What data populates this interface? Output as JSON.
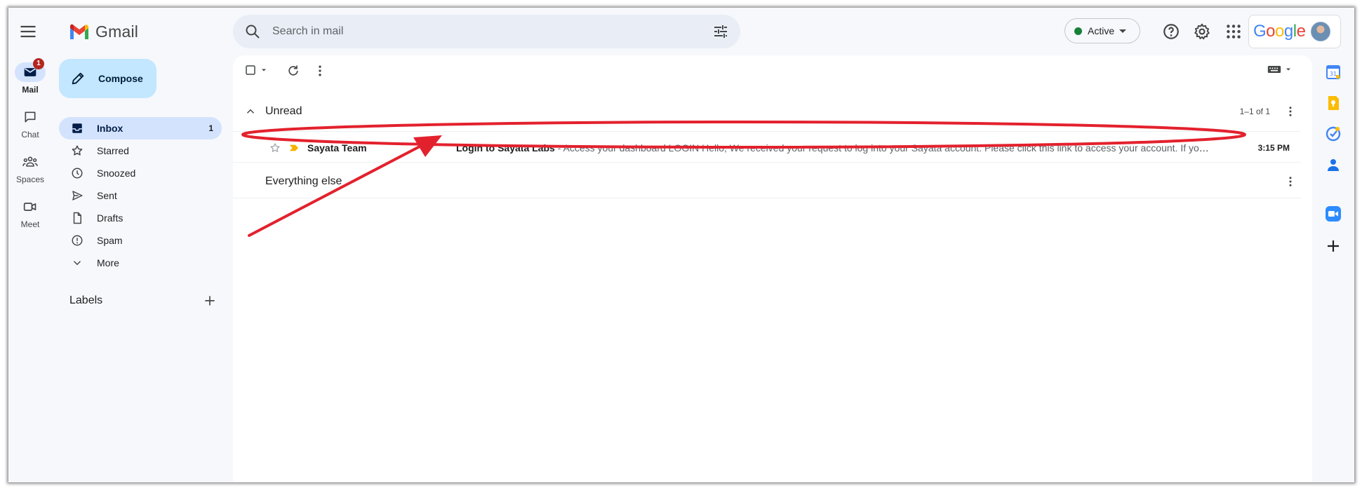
{
  "app": {
    "name": "Gmail"
  },
  "search": {
    "placeholder": "Search in mail"
  },
  "status": {
    "label": "Active",
    "color": "#188038"
  },
  "account": {
    "brand": "Google",
    "brand_colors": [
      "#4285F4",
      "#EA4335",
      "#FBBC05",
      "#4285F4",
      "#34A853",
      "#EA4335"
    ]
  },
  "rail": {
    "items": [
      {
        "label": "Mail",
        "icon": "mail-icon",
        "badge": "1",
        "active": true
      },
      {
        "label": "Chat",
        "icon": "chat-icon"
      },
      {
        "label": "Spaces",
        "icon": "spaces-icon"
      },
      {
        "label": "Meet",
        "icon": "meet-icon"
      }
    ]
  },
  "compose": {
    "label": "Compose"
  },
  "nav": {
    "items": [
      {
        "label": "Inbox",
        "icon": "inbox-icon",
        "count": "1",
        "active": true
      },
      {
        "label": "Starred",
        "icon": "star-icon"
      },
      {
        "label": "Snoozed",
        "icon": "clock-icon"
      },
      {
        "label": "Sent",
        "icon": "send-icon"
      },
      {
        "label": "Drafts",
        "icon": "draft-icon"
      },
      {
        "label": "Spam",
        "icon": "spam-icon"
      },
      {
        "label": "More",
        "icon": "chevron-down-icon"
      }
    ]
  },
  "labels": {
    "title": "Labels"
  },
  "sections": {
    "unread": {
      "title": "Unread",
      "count": "1–1 of 1"
    },
    "everything_else": {
      "title": "Everything else"
    }
  },
  "emails": [
    {
      "sender": "Sayata Team",
      "subject": "Login to Sayata Labs",
      "snippet": " - Access your dashboard LOGIN Hello, We received your request to log into your Sayata account. Please click this link to access your account. If you have any questions",
      "time": "3:15 PM",
      "unread": true,
      "important": true
    }
  ],
  "theme": {
    "accent": "#c2e7ff",
    "active_nav": "#d3e3fd",
    "annotation": "#e3212d"
  }
}
